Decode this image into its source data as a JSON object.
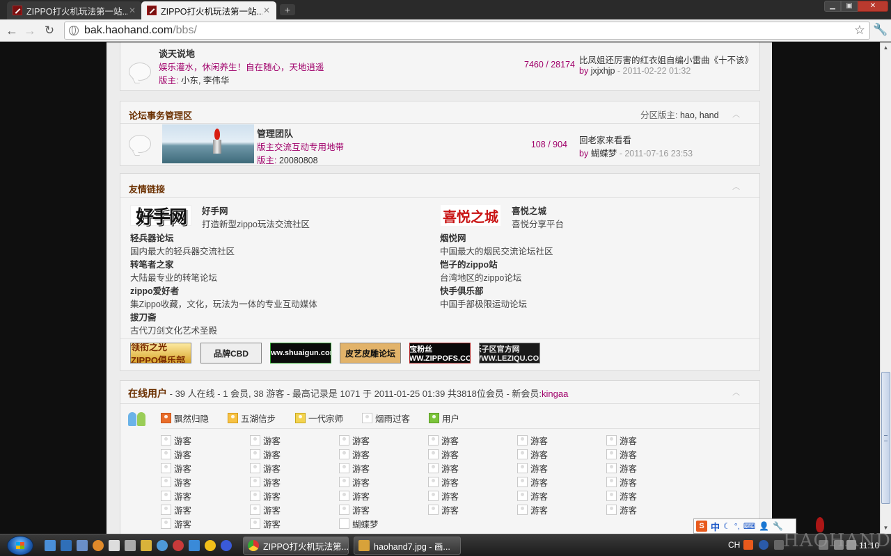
{
  "browser": {
    "tabs": [
      {
        "title": "ZIPPO打火机玩法第一站..."
      },
      {
        "title": "ZIPPO打火机玩法第一站..."
      }
    ],
    "url_host": "bak.haohand.com",
    "url_path": "/bbs/"
  },
  "forum1": {
    "name": "谈天说地",
    "desc": "娱乐灌水，休闲养生！自在随心，天地逍遥",
    "mod_label": "版主:",
    "mods": "小东, 李伟华",
    "stats": "7460 / 28174",
    "lastpost_title": "比凤姐还厉害的红衣姐自编小雷曲《十不该》",
    "lastpost_by": "by",
    "lastpost_user": "jxjxhjp",
    "lastpost_time": "- 2011-02-22 01:32"
  },
  "section2": {
    "title": "论坛事务管理区",
    "mod_label": "分区版主:",
    "mods": "hao, hand"
  },
  "forum2": {
    "name": "管理团队",
    "desc": "版主交流互动专用地带",
    "mod_label": "版主:",
    "mods": "20080808",
    "stats": "108 / 904",
    "lastpost_title": "回老家来看看",
    "lastpost_by": "by",
    "lastpost_user": "蝴蝶梦",
    "lastpost_time": "- 2011-07-16 23:53"
  },
  "links": {
    "title": "友情链接",
    "logo_haoshou": "好手网",
    "logo_xiyue": "喜悦之城",
    "left": [
      {
        "name": "好手网",
        "desc": "打造新型zippo玩法交流社区"
      },
      {
        "name": "轻兵器论坛",
        "desc": "国内最大的轻兵器交流社区"
      },
      {
        "name": "转笔者之家",
        "desc": "大陆最专业的转笔论坛"
      },
      {
        "name": "zippo爱好者",
        "desc": "集Zippo收藏，文化，玩法为一体的专业互动媒体"
      },
      {
        "name": "拔刀斋",
        "desc": "古代刀剑文化艺术圣殿"
      }
    ],
    "right": [
      {
        "name": "喜悦之城",
        "desc": "喜悦分享平台"
      },
      {
        "name": "烟悦网",
        "desc": "中国最大的烟民交流论坛社区"
      },
      {
        "name": "恺子的zippo站",
        "desc": "台湾地区的zippo论坛"
      },
      {
        "name": "快手俱乐部",
        "desc": "中国手部极限运动论坛"
      }
    ],
    "banners": [
      "领衔之光 ZIPPO俱乐部",
      "品牌CBD",
      "www.shuaigun.com",
      "皮艺皮雕论坛",
      "芝宝粉丝 WWW.ZIPPOFS.COM",
      "乐子区官方网 WWW.LEZIQU.COM"
    ]
  },
  "online": {
    "title": "在线用户",
    "info": "- 39 人在线 - 1 会员, 38 游客 - 最高记录是 1071 于 2011-01-25 01:39 共3818位会员 - 新会员:",
    "new_member": "kingaa",
    "legend": [
      "飘然归隐",
      "五湖信步",
      "一代宗师",
      "烟雨过客",
      "用户"
    ],
    "guest_label": "游客",
    "member": "蝴蝶梦"
  },
  "ime": {
    "logo": "S",
    "mode": "中"
  },
  "taskbar": {
    "apps": [
      "ZIPPO打火机玩法第...",
      "haohand7.jpg - 画..."
    ],
    "lang": "CH",
    "clock": "11:10"
  },
  "watermark": "HAOHAND"
}
